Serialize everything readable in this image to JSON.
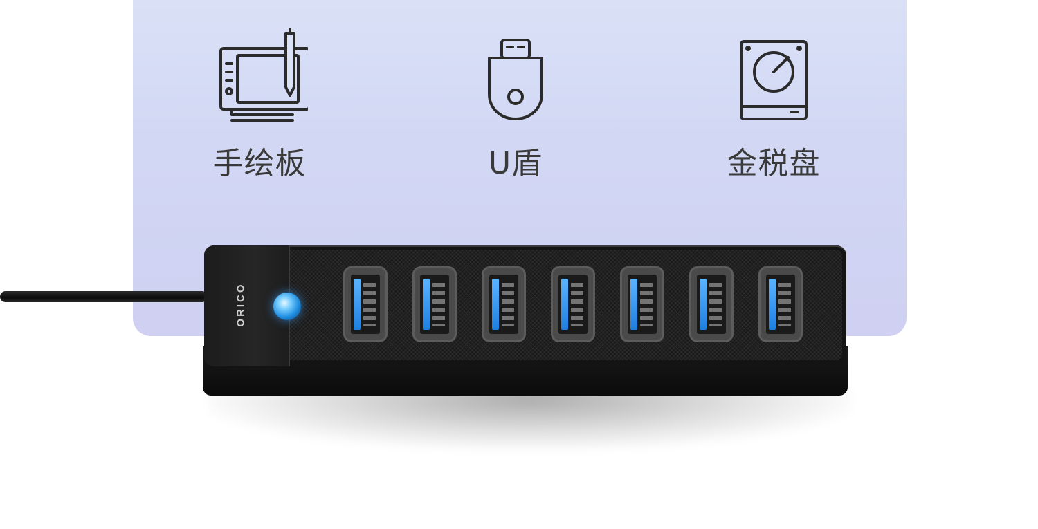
{
  "features": [
    {
      "label": "手绘板",
      "icon": "drawing-tablet-icon"
    },
    {
      "label": "U盾",
      "icon": "usb-key-icon"
    },
    {
      "label": "金税盘",
      "icon": "tax-disk-icon"
    }
  ],
  "product": {
    "brand": "ORICO",
    "port_count": 7,
    "colors": {
      "body": "#141414",
      "port_tongue": "#2a8cf0",
      "led": "#3aa8ff"
    }
  },
  "colors": {
    "panel_top": "#dbe2f7",
    "panel_bottom": "#cfd0f2",
    "label": "#3a3a3a"
  }
}
